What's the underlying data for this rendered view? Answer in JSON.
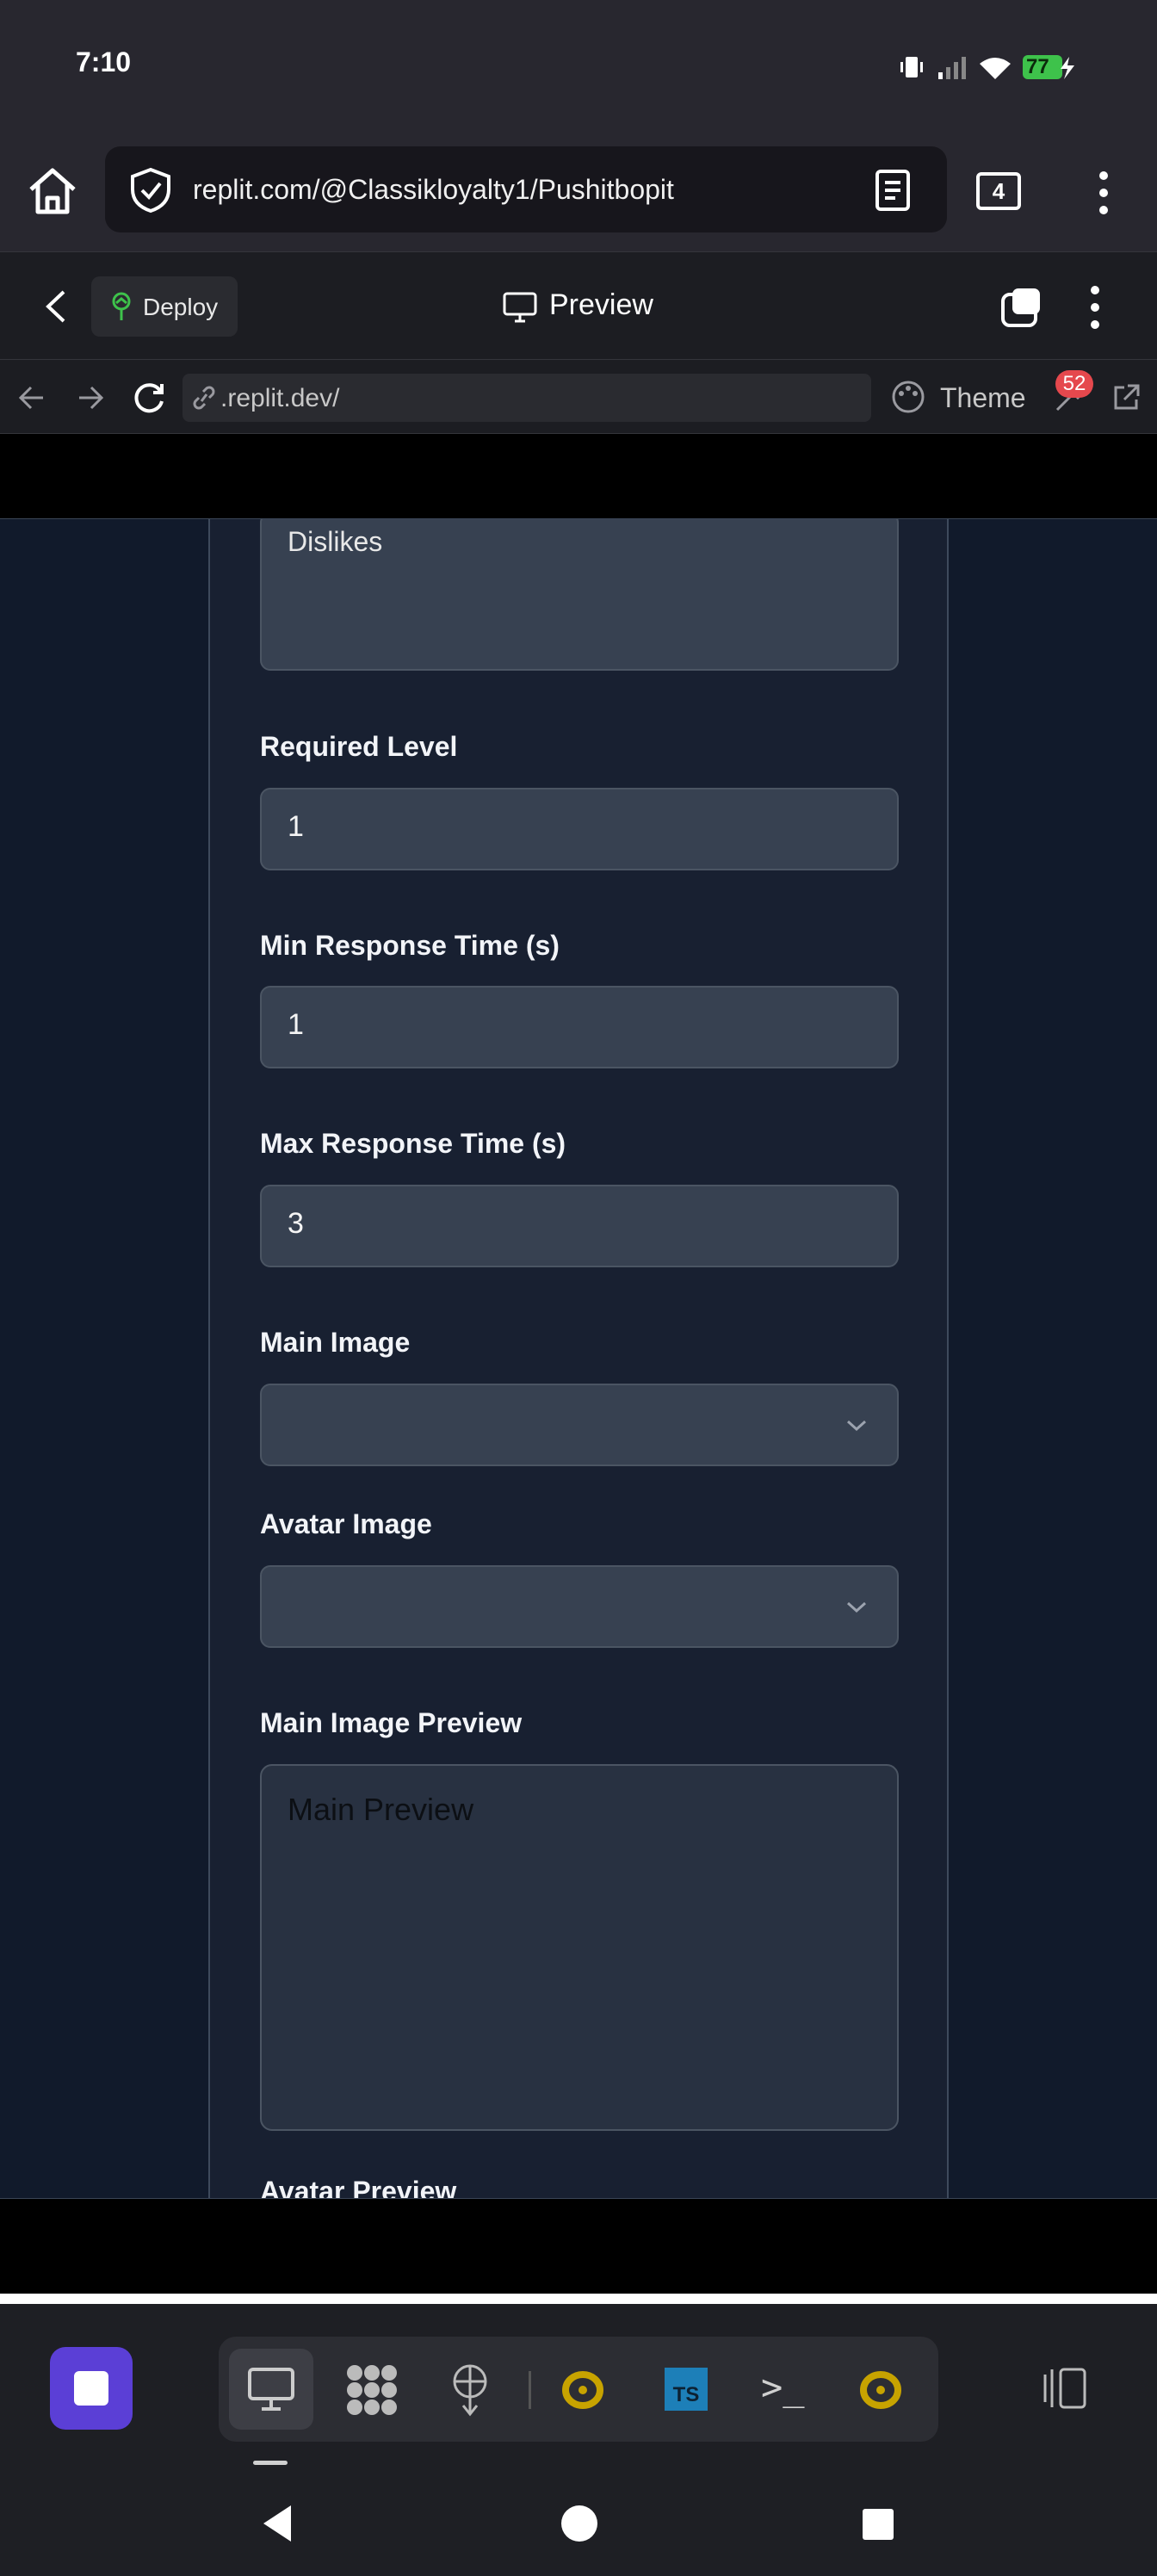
{
  "status_bar": {
    "time": "7:10",
    "battery": "77"
  },
  "browser": {
    "url": "replit.com/@Classikloyalty1/Pushitbopit",
    "tab_count": "4"
  },
  "replit_header": {
    "deploy_label": "Deploy",
    "title": "Preview"
  },
  "preview_nav": {
    "url": ".replit.dev/",
    "theme_label": "Theme",
    "badge_count": "52"
  },
  "form": {
    "dislikes_placeholder": "Dislikes",
    "required_level": {
      "label": "Required Level",
      "value": "1"
    },
    "min_response": {
      "label": "Min Response Time (s)",
      "value": "1"
    },
    "max_response": {
      "label": "Max Response Time (s)",
      "value": "3"
    },
    "main_image": {
      "label": "Main Image",
      "value": ""
    },
    "avatar_image": {
      "label": "Avatar Image",
      "value": ""
    },
    "main_image_preview": {
      "label": "Main Image Preview",
      "placeholder": "Main Preview"
    },
    "avatar_preview": {
      "label": "Avatar Preview"
    }
  },
  "taskbar": {
    "ts_label": "TS",
    "terminal_label": ">_"
  },
  "colors": {
    "accent": "#5b3fd6",
    "battery": "#3ec24b",
    "badge": "#e5484d",
    "page_bg": "#111a2b",
    "card_bg": "#182031",
    "input_bg": "#374151"
  }
}
